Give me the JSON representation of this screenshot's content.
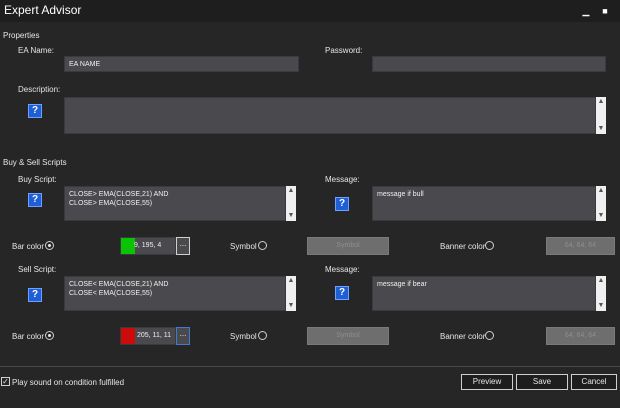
{
  "window": {
    "title": "Expert Advisor",
    "minimize": "▁",
    "maximize": "■"
  },
  "properties": {
    "section": "Properties",
    "ea_name_label": "EA Name:",
    "ea_name_value": "EA NAME",
    "password_label": "Password:",
    "password_value": "",
    "description_label": "Description:",
    "description_value": ""
  },
  "scripts": {
    "section": "Buy & Sell Scripts",
    "buy": {
      "script_label": "Buy Script:",
      "script_value": "CLOSE> EMA(CLOSE,21) AND\nCLOSE> EMA(CLOSE,55)",
      "message_label": "Message:",
      "message_value": "message if bull",
      "bar_color_label": "Bar color",
      "bar_color_value": "9, 195, 4",
      "bar_color_hex": "#09c304",
      "symbol_label": "Symbol",
      "symbol_button": "Symbol",
      "banner_color_label": "Banner color",
      "banner_color_value": "64, 64, 64"
    },
    "sell": {
      "script_label": "Sell Script:",
      "script_value": "CLOSE< EMA(CLOSE,21) AND\nCLOSE< EMA(CLOSE,55)",
      "message_label": "Message:",
      "message_value": "message if bear",
      "bar_color_label": "Bar color",
      "bar_color_value": "205, 11, 11",
      "bar_color_hex": "#cd0b0b",
      "symbol_label": "Symbol",
      "symbol_button": "Symbol",
      "banner_color_label": "Banner color",
      "banner_color_value": "64, 64, 64"
    }
  },
  "footer": {
    "play_sound_label": "Play sound on condition fulfilled",
    "play_sound_checked": true,
    "preview": "Preview",
    "save": "Save",
    "cancel": "Cancel"
  },
  "icons": {
    "help": "?",
    "ellipsis": "...",
    "check": "✓",
    "up": "▲",
    "down": "▼"
  }
}
